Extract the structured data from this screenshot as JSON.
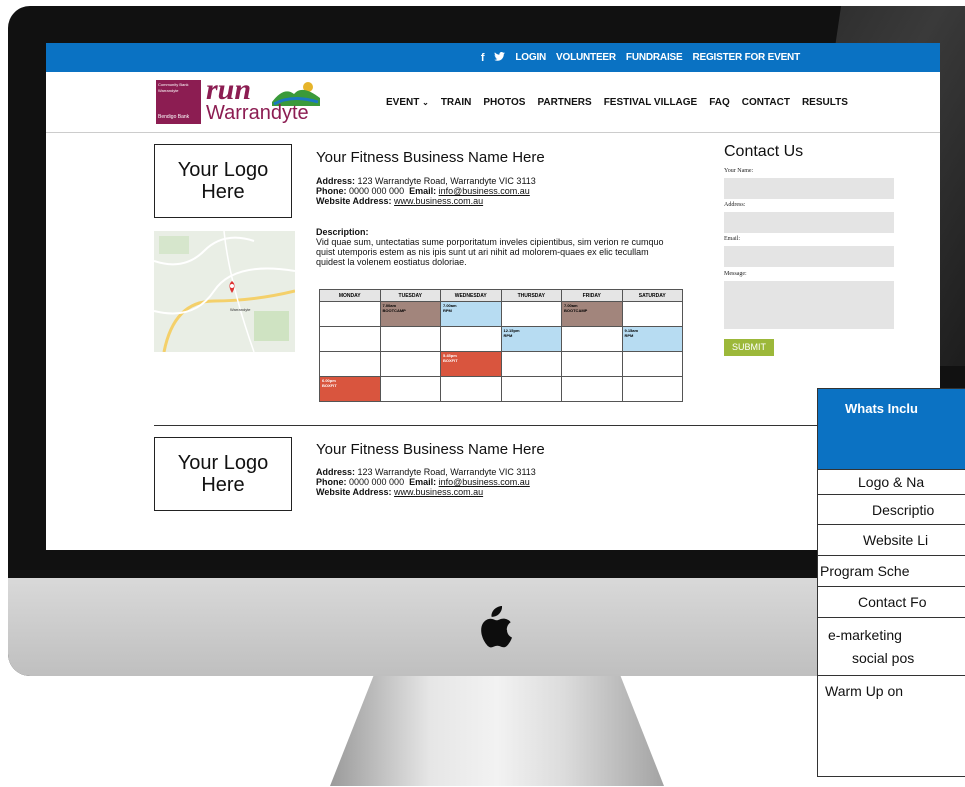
{
  "top_nav": {
    "icons": [
      "facebook-icon",
      "twitter-icon"
    ],
    "facebook_glyph": "f",
    "twitter_glyph": "🐦",
    "links": [
      "LOGIN",
      "VOLUNTEER",
      "FUNDRAISE",
      "REGISTER FOR EVENT"
    ]
  },
  "brand": {
    "bank_line1": "Community Bank",
    "bank_line2": "Warrandyte",
    "bank_line3": "Bendigo Bank",
    "run": "run",
    "warrandyte": "Warrandyte"
  },
  "main_nav": {
    "event": "EVENT",
    "items": [
      "TRAIN",
      "PHOTOS",
      "PARTNERS",
      "FESTIVAL VILLAGE",
      "FAQ",
      "CONTACT",
      "RESULTS"
    ]
  },
  "listing1": {
    "logo_text_line1": "Your Logo",
    "logo_text_line2": "Here",
    "business_name": "Your Fitness Business Name Here",
    "address_label": "Address:",
    "address": "123 Warrandyte Road, Warrandyte VIC 3113",
    "phone_label": "Phone:",
    "phone": "0000 000 000",
    "email_label": "Email:",
    "email": "info@business.com.au",
    "website_label": "Website Address:",
    "website": "www.business.com.au",
    "description_label": "Description:",
    "description": "Vid quae sum, untectatias sume porporitatum inveles cipientibus, sim verion re cumquo quist utemporis estem as nis ipis sunt ut ari nihit ad molorem-quaes ex elic tecullam quidest la volenem eostiatus doloriae.",
    "map_pin_label": "Warrandyte"
  },
  "schedule": {
    "days": [
      "MONDAY",
      "TUESDAY",
      "WEDNESDAY",
      "THURSDAY",
      "FRIDAY",
      "SATURDAY"
    ],
    "rows": [
      [
        null,
        {
          "time": "7.00am",
          "cls": "BOOTCAMP",
          "color": "boot"
        },
        {
          "time": "7.00am",
          "cls": "RPM",
          "color": "rpm"
        },
        null,
        {
          "time": "7.00am",
          "cls": "BOOTCAMP",
          "color": "boot"
        },
        null
      ],
      [
        null,
        null,
        null,
        {
          "time": "12.15pm",
          "cls": "RPM",
          "color": "rpm"
        },
        null,
        {
          "time": "9.15am",
          "cls": "RPM",
          "color": "rpm"
        }
      ],
      [
        null,
        null,
        {
          "time": "5.45pm",
          "cls": "BOXFIT",
          "color": "box"
        },
        null,
        null,
        null
      ],
      [
        {
          "time": "6.00pm",
          "cls": "BOXFIT",
          "color": "box"
        },
        null,
        null,
        null,
        null,
        null
      ]
    ]
  },
  "contact": {
    "title": "Contact Us",
    "name_label": "Your Name:",
    "address_label": "Address:",
    "email_label": "Email:",
    "message_label": "Message:",
    "submit": "SUBMIT"
  },
  "listing2": {
    "logo_text_line1": "Your Logo",
    "logo_text_line2": "Here",
    "business_name": "Your Fitness Business Name Here",
    "address_label": "Address:",
    "address": "123 Warrandyte Road, Warrandyte VIC 3113",
    "phone_label": "Phone:",
    "phone": "0000 000 000",
    "email_label": "Email:",
    "email": "info@business.com.au",
    "website_label": "Website Address:",
    "website": "www.business.com.au"
  },
  "included": {
    "header": "Whats Inclu",
    "rows": [
      "Logo & Na",
      "Descriptio",
      "Website Li",
      "Program Sche",
      "Contact Fo",
      "e-marketing",
      "social pos",
      "Warm Up on"
    ]
  },
  "colors": {
    "topbar": "#0a72c3",
    "brand": "#8c1d52",
    "bootcamp": "#a2857c",
    "rpm": "#b7dcf2",
    "boxfit": "#d9553e",
    "submit": "#9cb83a"
  }
}
